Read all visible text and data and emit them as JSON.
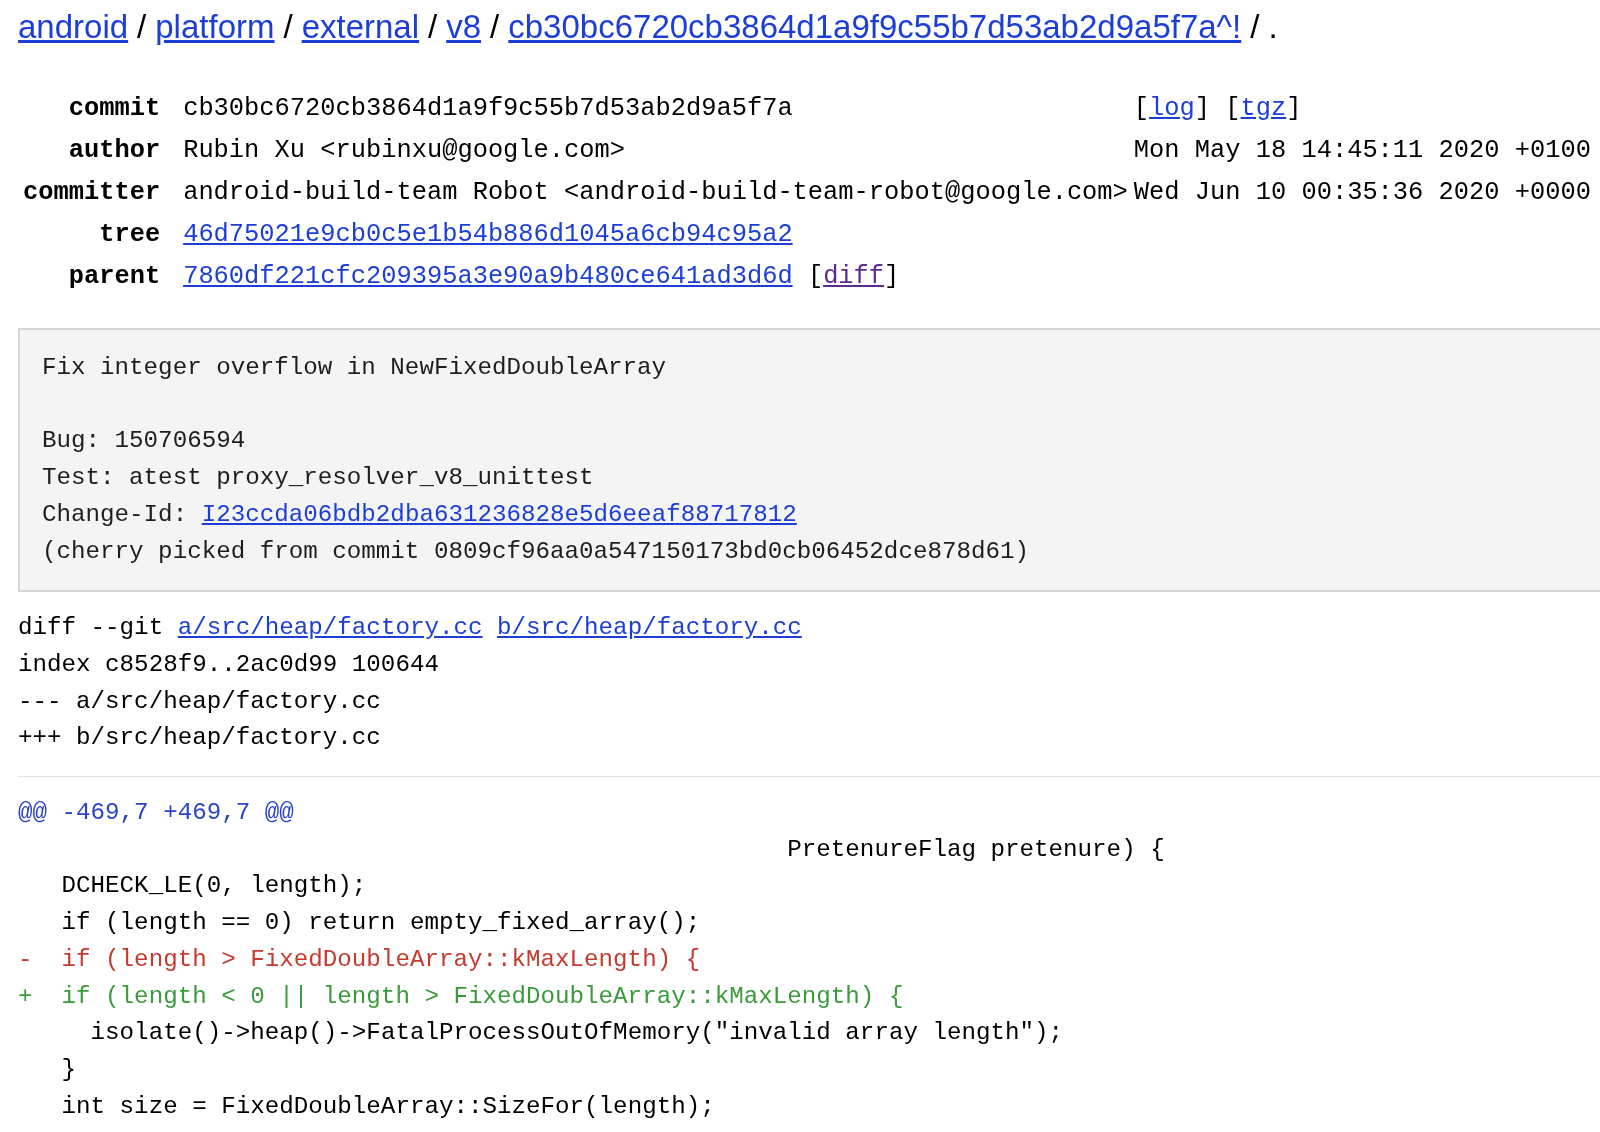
{
  "breadcrumb": {
    "separator": "/",
    "items": [
      {
        "kind": "link",
        "label": "android"
      },
      {
        "kind": "link",
        "label": "platform"
      },
      {
        "kind": "link",
        "label": "external"
      },
      {
        "kind": "link",
        "label": "v8"
      },
      {
        "kind": "link",
        "label": "cb30bc6720cb3864d1a9f9c55b7d53ab2d9a5f7a^!"
      },
      {
        "kind": "current",
        "label": "."
      }
    ]
  },
  "metadata": [
    {
      "kind": "text",
      "label": "commit",
      "value": "cb30bc6720cb3864d1a9f9c55b7d53ab2d9a5f7a",
      "actions": [
        {
          "open": "[",
          "label": "log",
          "close": "]",
          "visited": false
        },
        {
          "open": "[",
          "label": "tgz",
          "close": "]",
          "visited": false
        }
      ]
    },
    {
      "kind": "text",
      "label": "author",
      "value": "Rubin Xu <rubinxu@google.com>",
      "date": "Mon May 18 14:45:11 2020 +0100"
    },
    {
      "kind": "text",
      "label": "committer",
      "value": "android-build-team Robot <android-build-team-robot@google.com>",
      "date": "Wed Jun 10 00:35:36 2020 +0000"
    },
    {
      "kind": "link",
      "label": "tree",
      "value": "46d75021e9cb0c5e1b54b886d1045a6cb94c95a2"
    },
    {
      "kind": "link",
      "label": "parent",
      "value": "7860df221cfc209395a3e90a9b480ce641ad3d6d",
      "value_actions": [
        {
          "open": "[",
          "label": "diff",
          "close": "]",
          "visited": true
        }
      ]
    }
  ],
  "message": {
    "subject": "Fix integer overflow in NewFixedDoubleArray",
    "body": [
      {
        "text": "Bug: 150706594"
      },
      {
        "text": "Test: atest proxy_resolver_v8_unittest"
      },
      {
        "text": "Change-Id:",
        "link": "I23ccda06bdb2dba631236828e5d6eeaf88717812"
      },
      {
        "text": "(cherry picked from commit 0809cf96aa0a547150173bd0cb06452dce878d61)"
      }
    ]
  },
  "diff": {
    "header": [
      {
        "text": "diff --git",
        "links": [
          "a/src/heap/factory.cc",
          "b/src/heap/factory.cc"
        ]
      },
      {
        "text": "index c8528f9..2ac0d99 100644"
      },
      {
        "text": "--- a/src/heap/factory.cc"
      },
      {
        "text": "+++ b/src/heap/factory.cc"
      }
    ],
    "hunk_header": "@@ -469,7 +469,7 @@",
    "lines": [
      {
        "kind": "context",
        "text": "                                                     PretenureFlag pretenure) {"
      },
      {
        "kind": "context",
        "text": "   DCHECK_LE(0, length);"
      },
      {
        "kind": "context",
        "text": "   if (length == 0) return empty_fixed_array();"
      },
      {
        "kind": "removed",
        "text": "-  if (length > FixedDoubleArray::kMaxLength) {"
      },
      {
        "kind": "added",
        "text": "+  if (length < 0 || length > FixedDoubleArray::kMaxLength) {"
      },
      {
        "kind": "context",
        "text": "     isolate()->heap()->FatalProcessOutOfMemory(\"invalid array length\");"
      },
      {
        "kind": "context",
        "text": "   }"
      },
      {
        "kind": "context",
        "text": "   int size = FixedDoubleArray::SizeFor(length);"
      }
    ]
  }
}
